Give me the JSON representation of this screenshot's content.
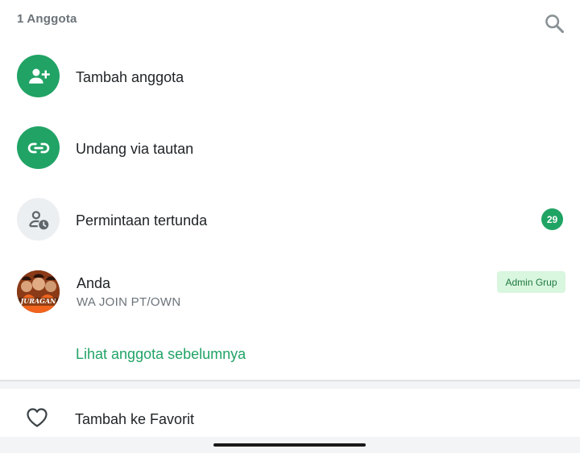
{
  "header": {
    "member_count": "1 Anggota",
    "search_icon": "search-icon"
  },
  "actions": [
    {
      "label": "Tambah anggota",
      "icon": "person-add-icon"
    },
    {
      "label": "Undang via tautan",
      "icon": "link-icon"
    },
    {
      "label": "Permintaan tertunda",
      "icon": "pending-person-icon",
      "badge": "29"
    }
  ],
  "member": {
    "name": "Anda",
    "status": "WA JOIN PT/OWN",
    "role_badge": "Admin Grup",
    "avatar_text": "JURAGAN"
  },
  "see_more_label": "Lihat anggota sebelumnya",
  "favorite": {
    "label": "Tambah ke Favorit",
    "icon": "heart-outline-icon"
  },
  "colors": {
    "accent": "#21a366",
    "badge_bg": "#1fa463",
    "admin_badge_bg": "#d9f6df",
    "admin_badge_text": "#1f7a3f"
  }
}
